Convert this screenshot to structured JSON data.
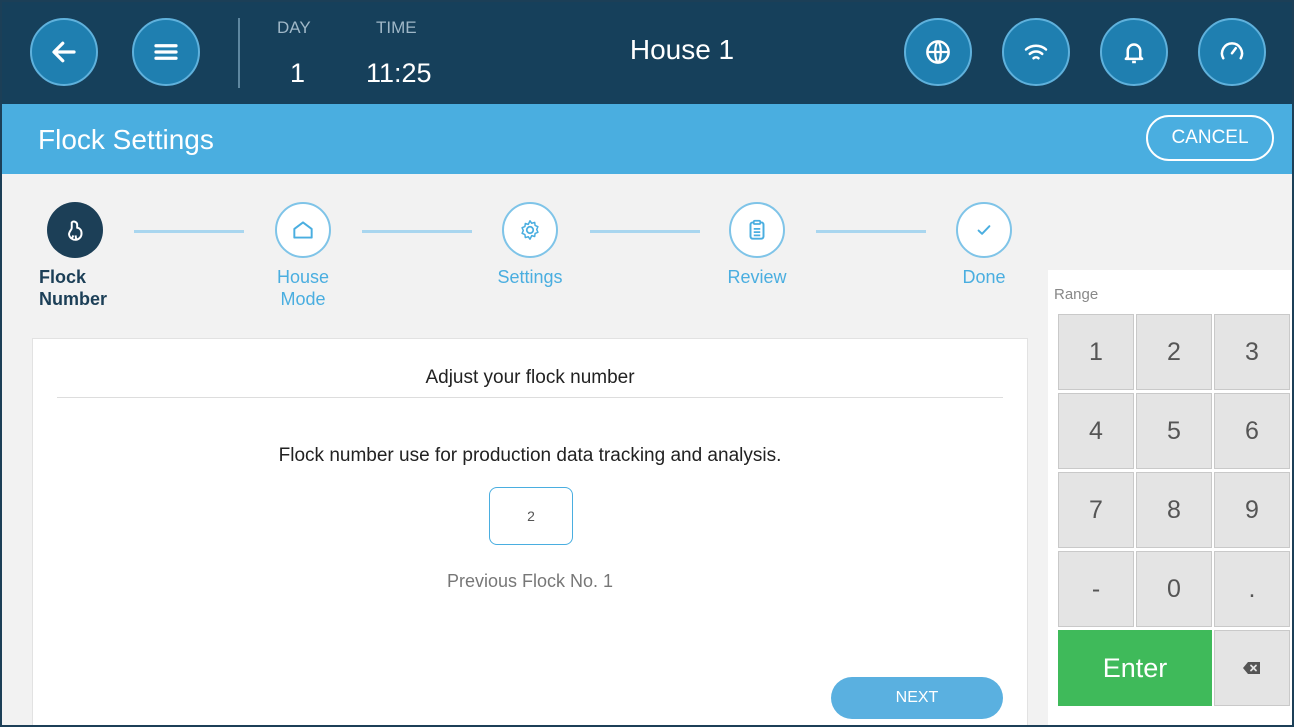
{
  "topbar": {
    "day_label": "DAY",
    "day_value": "1",
    "time_label": "TIME",
    "time_value": "11:25",
    "house_title": "House 1",
    "icons": [
      "back-arrow-icon",
      "menu-icon",
      "globe-icon",
      "wifi-icon",
      "bell-icon",
      "gauge-icon"
    ]
  },
  "header": {
    "title": "Flock Settings",
    "cancel_label": "CANCEL"
  },
  "steps": [
    {
      "line1": "Flock",
      "line2": "Number",
      "icon": "bird-icon",
      "state": "active"
    },
    {
      "line1": "House",
      "line2": "Mode",
      "icon": "house-icon",
      "state": "pending"
    },
    {
      "line1": "Settings",
      "line2": "",
      "icon": "gear-icon",
      "state": "pending"
    },
    {
      "line1": "Review",
      "line2": "",
      "icon": "clipboard-icon",
      "state": "pending"
    },
    {
      "line1": "Done",
      "line2": "",
      "icon": "check-icon",
      "state": "pending"
    }
  ],
  "card": {
    "title": "Adjust your flock number",
    "description": "Flock number use for production data tracking and analysis.",
    "input_value": "2",
    "previous": "Previous Flock No. 1",
    "next_label": "NEXT"
  },
  "keypad": {
    "range_label": "Range",
    "keys": [
      "1",
      "2",
      "3",
      "4",
      "5",
      "6",
      "7",
      "8",
      "9",
      "-",
      "0",
      "."
    ],
    "enter_label": "Enter",
    "backspace_icon": "backspace-icon"
  },
  "colors": {
    "topbar": "#16405b",
    "header": "#4aaee0",
    "enter": "#3fba5a",
    "active_step": "#1c3f57"
  }
}
